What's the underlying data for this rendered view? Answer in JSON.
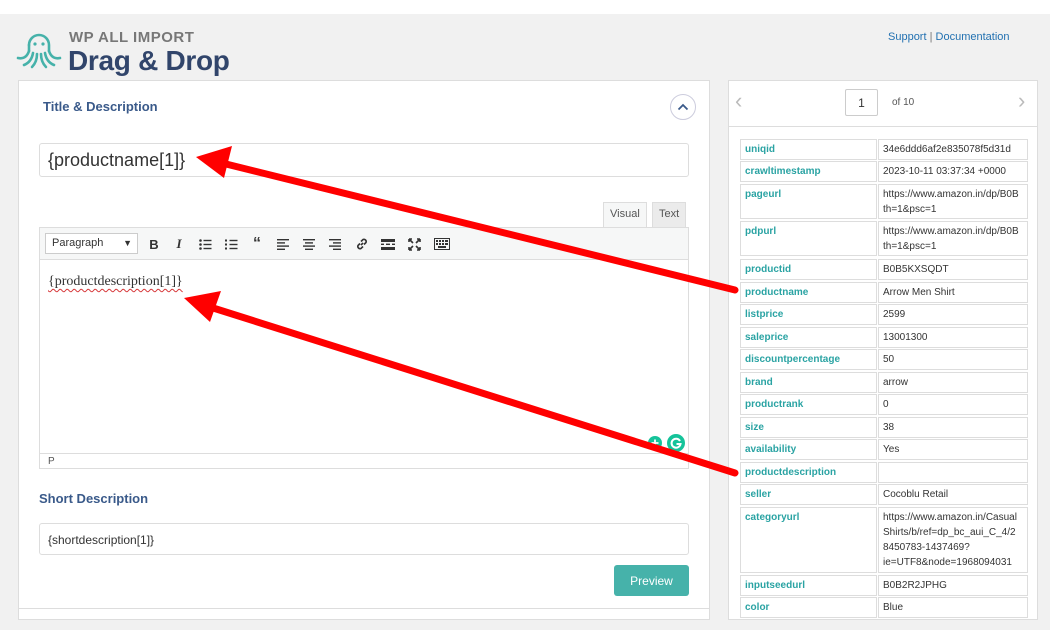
{
  "header": {
    "brand_small": "WP ALL IMPORT",
    "brand_big": "Drag & Drop",
    "support_label": "Support",
    "separator": "|",
    "docs_label": "Documentation"
  },
  "left": {
    "title_section": "Title & Description",
    "title_value": "{productname[1]}",
    "tabs": {
      "visual": "Visual",
      "text": "Text"
    },
    "format_select": "Paragraph",
    "editor_content": "{productdescription[1]}",
    "status_path": "P",
    "short_section": "Short Description",
    "short_value": "{shortdescription[1]}",
    "preview_label": "Preview"
  },
  "right": {
    "page_current": "1",
    "page_of": "of 10",
    "rows": [
      {
        "key": "uniqid",
        "value": "34e6ddd6af2e835078f5d31d"
      },
      {
        "key": "crawltimestamp",
        "value": "2023-10-11 03:37:34 +0000"
      },
      {
        "key": "pageurl",
        "value": "https://www.amazon.in/dp/B0B th=1&psc=1"
      },
      {
        "key": "pdpurl",
        "value": "https://www.amazon.in/dp/B0B th=1&psc=1"
      },
      {
        "key": "productid",
        "value": "B0B5KXSQDT"
      },
      {
        "key": "productname",
        "value": "Arrow Men Shirt"
      },
      {
        "key": "listprice",
        "value": "2599"
      },
      {
        "key": "saleprice",
        "value": "13001300"
      },
      {
        "key": "discountpercentage",
        "value": "50"
      },
      {
        "key": "brand",
        "value": "arrow"
      },
      {
        "key": "productrank",
        "value": "0"
      },
      {
        "key": "size",
        "value": "38"
      },
      {
        "key": "availability",
        "value": "Yes"
      },
      {
        "key": "productdescription",
        "value": ""
      },
      {
        "key": "seller",
        "value": "Cocoblu Retail"
      },
      {
        "key": "categoryurl",
        "value": "https://www.amazon.in/Casual Shirts/b/ref=dp_bc_aui_C_4/2 8450783-1437469? ie=UTF8&node=1968094031"
      },
      {
        "key": "inputseedurl",
        "value": "B0B2R2JPHG"
      },
      {
        "key": "color",
        "value": "Blue"
      }
    ]
  },
  "colors": {
    "brand_navy": "#31456b",
    "key_teal": "#2aa3a3",
    "preview_button": "#46b2aa",
    "arrow_red": "#ff0000"
  }
}
